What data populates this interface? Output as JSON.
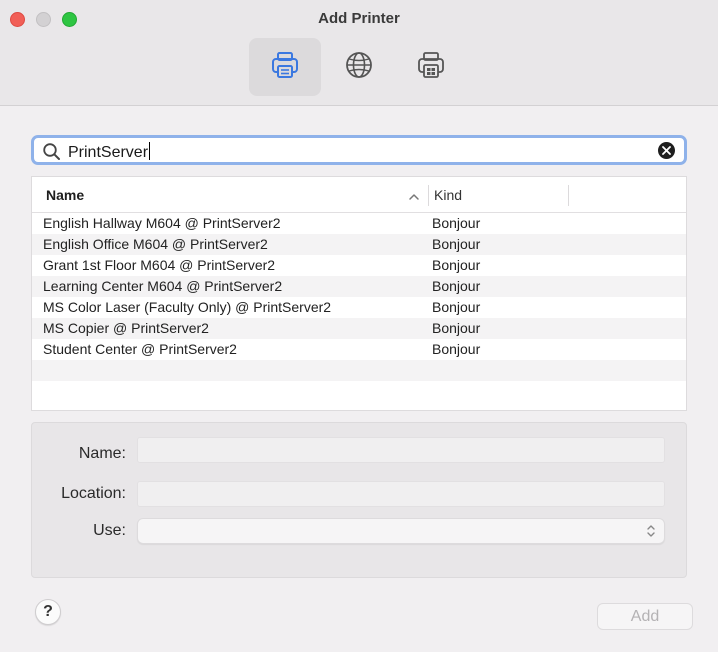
{
  "window": {
    "title": "Add Printer"
  },
  "toolbar": {
    "items": [
      {
        "name": "default",
        "icon": "printer-icon",
        "active": true
      },
      {
        "name": "ip",
        "icon": "globe-icon",
        "active": false
      },
      {
        "name": "windows",
        "icon": "windows-printer-icon",
        "active": false
      }
    ]
  },
  "search": {
    "value": "PrintServer",
    "placeholder": ""
  },
  "table": {
    "columns": {
      "name": "Name",
      "kind": "Kind"
    },
    "sort": {
      "column": "Name",
      "direction": "ascending"
    },
    "rows": [
      {
        "name": "English Hallway M604 @ PrintServer2",
        "kind": "Bonjour"
      },
      {
        "name": "English Office M604 @ PrintServer2",
        "kind": "Bonjour"
      },
      {
        "name": "Grant 1st Floor M604 @ PrintServer2",
        "kind": "Bonjour"
      },
      {
        "name": "Learning Center M604 @ PrintServer2",
        "kind": "Bonjour"
      },
      {
        "name": "MS Color Laser (Faculty Only) @ PrintServer2",
        "kind": "Bonjour"
      },
      {
        "name": "MS Copier @ PrintServer2",
        "kind": "Bonjour"
      },
      {
        "name": "Student Center @ PrintServer2",
        "kind": "Bonjour"
      },
      {
        "name": "",
        "kind": ""
      },
      {
        "name": "",
        "kind": ""
      }
    ]
  },
  "details": {
    "name_label": "Name:",
    "name_value": "",
    "location_label": "Location:",
    "location_value": "",
    "use_label": "Use:",
    "use_value": ""
  },
  "footer": {
    "help_label": "?",
    "add_label": "Add"
  },
  "colors": {
    "close": "#f15f57",
    "minimize": "#d3d1d3",
    "maximize": "#2ec542",
    "accent": "#4a7fe0",
    "focus_ring": "#8fb2ea"
  }
}
